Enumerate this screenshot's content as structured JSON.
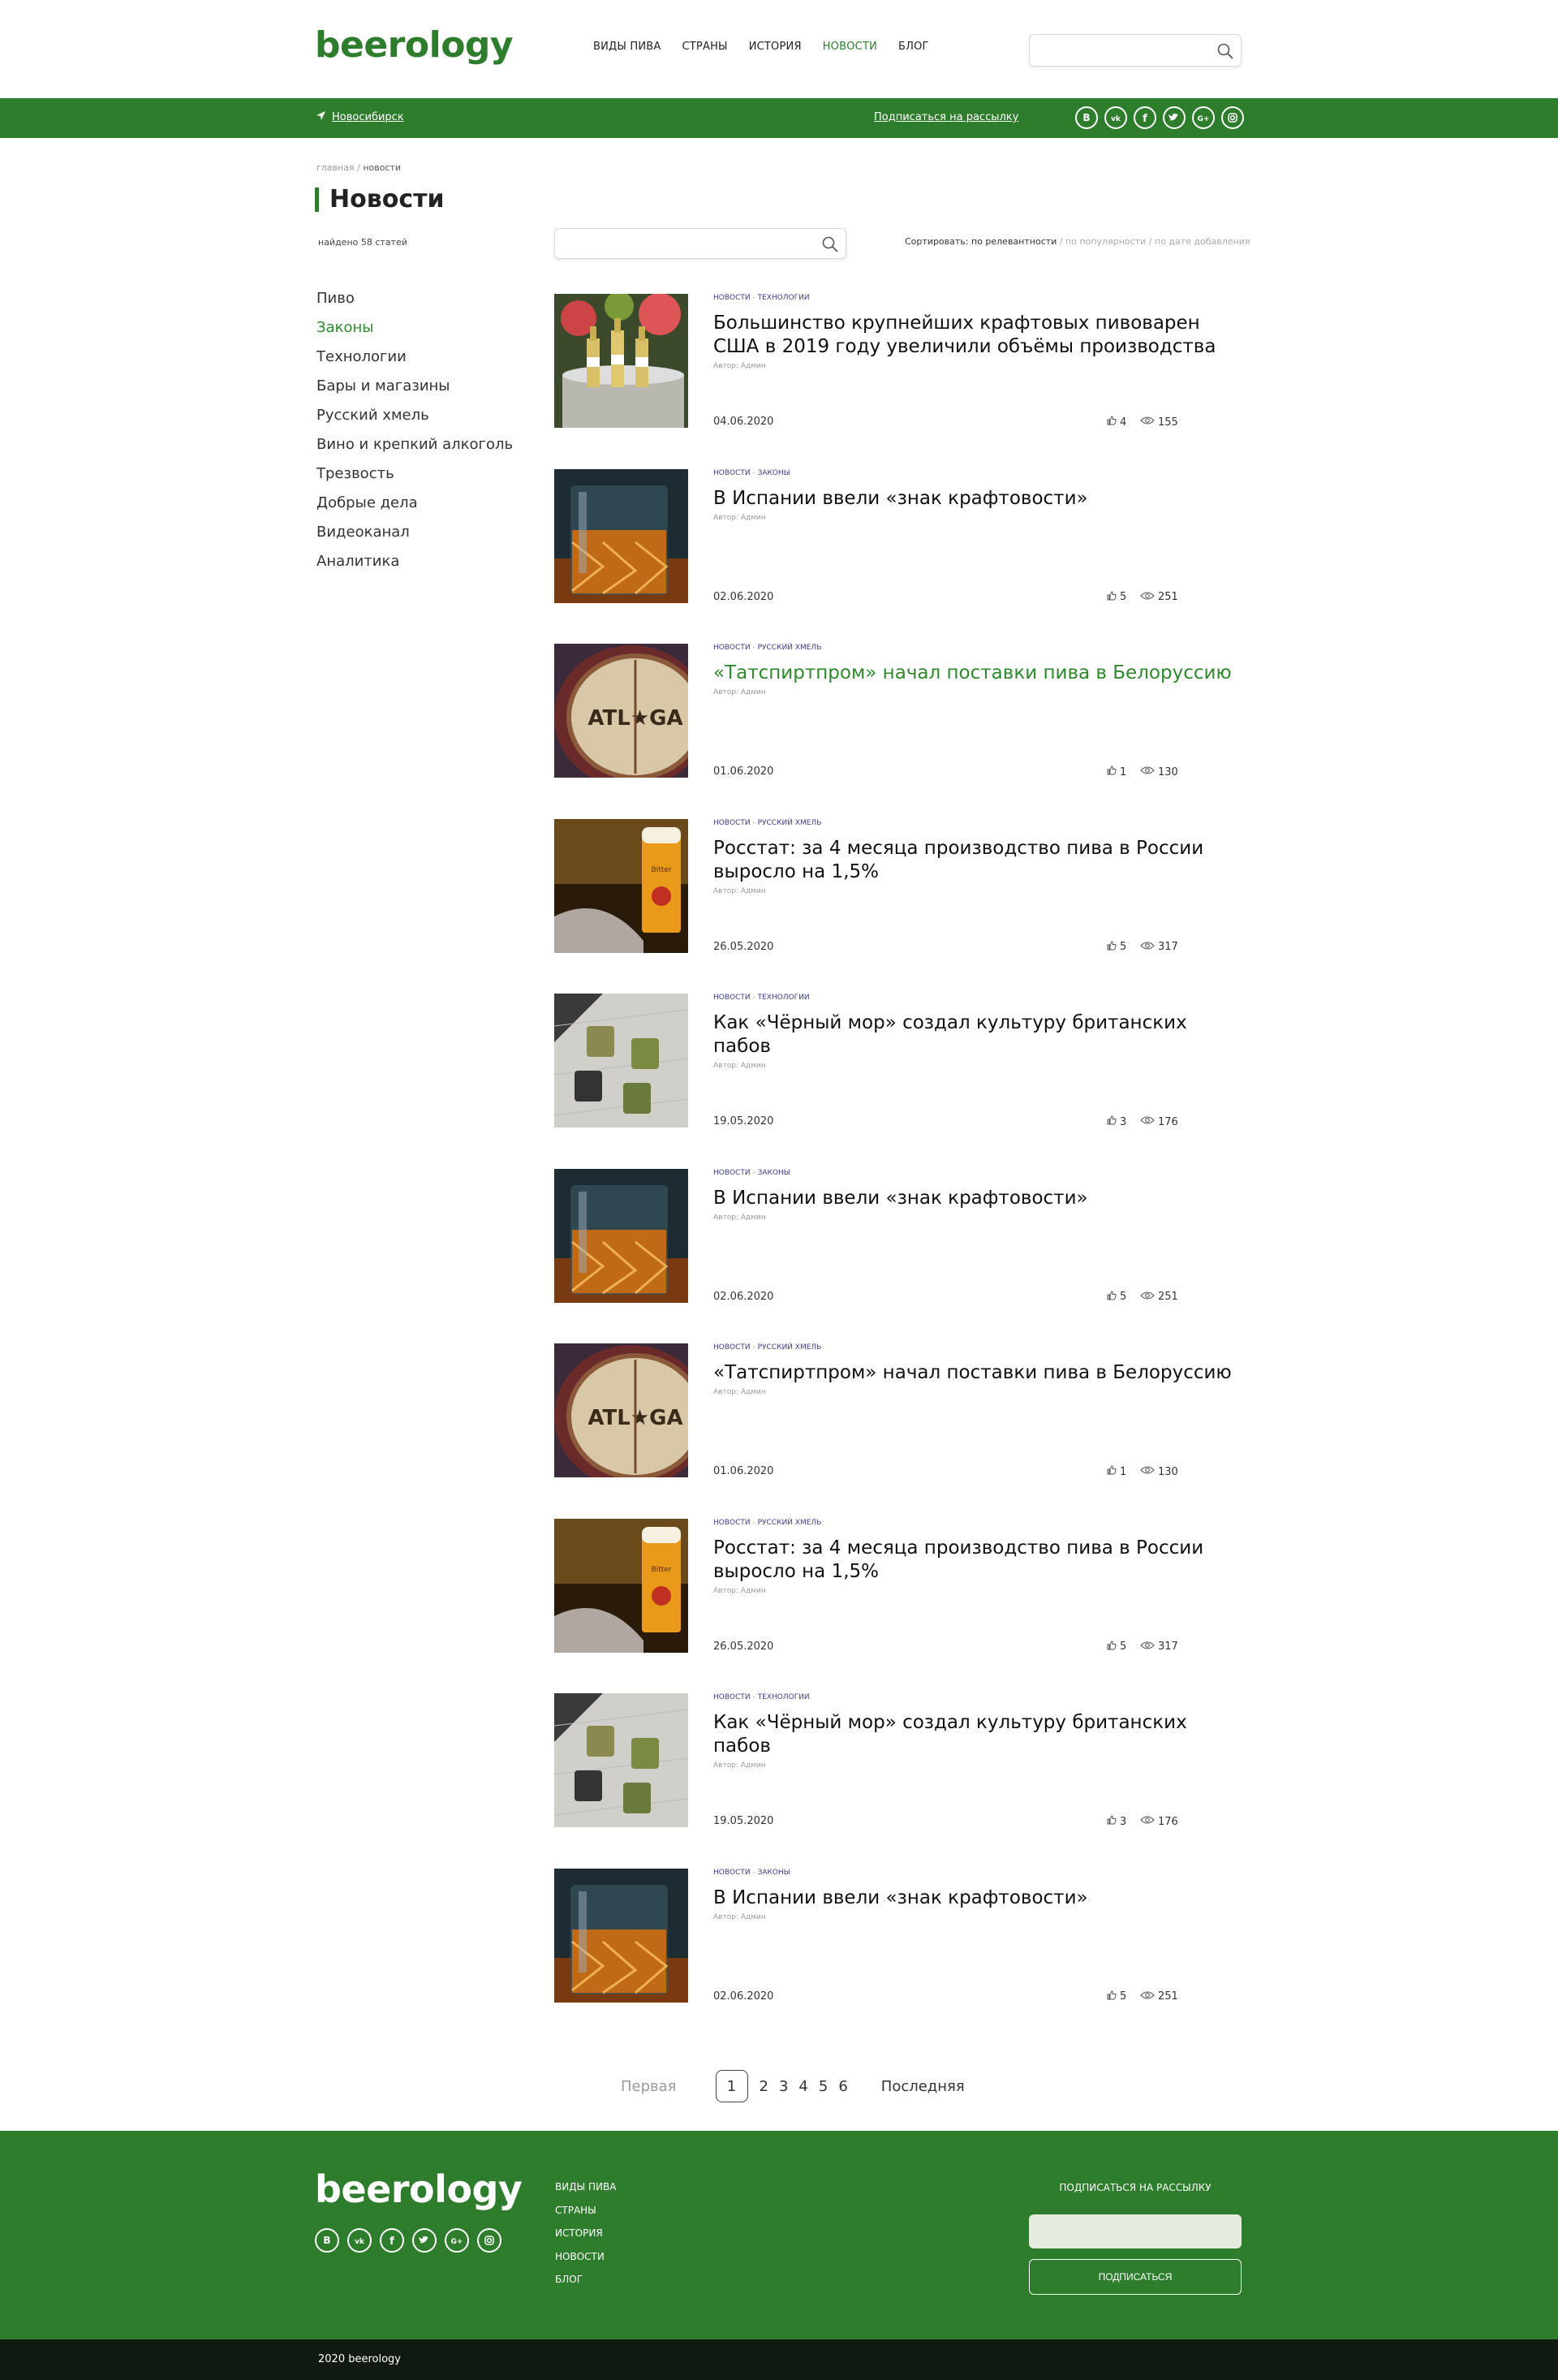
{
  "header": {
    "logo": "beerology",
    "nav": [
      {
        "label": "ВИДЫ ПИВА",
        "active": false
      },
      {
        "label": "СТРАНЫ",
        "active": false
      },
      {
        "label": "ИСТОРИЯ",
        "active": false
      },
      {
        "label": "НОВОСТИ",
        "active": true
      },
      {
        "label": "БЛОГ",
        "active": false
      }
    ],
    "search_placeholder": ""
  },
  "greenbar": {
    "city": "Новосибирск",
    "subscribe": "Подписаться на рассылку",
    "socials": [
      "В",
      "vk",
      "f",
      "twitter",
      "G+",
      "instagram"
    ]
  },
  "breadcrumb": {
    "home": "главная",
    "sep": "/",
    "current": "новости"
  },
  "page_title": "Новости",
  "found": "найдено 58 статей",
  "sort": {
    "label": "Сортировать:",
    "options": [
      {
        "label": "по релевантности",
        "active": true
      },
      {
        "label": "по популярности",
        "active": false
      },
      {
        "label": "по дате добавления",
        "active": false
      }
    ]
  },
  "sidebar": {
    "items": [
      {
        "label": "Пиво",
        "active": false
      },
      {
        "label": "Законы",
        "active": true
      },
      {
        "label": "Технологии",
        "active": false
      },
      {
        "label": "Бары и магазины",
        "active": false
      },
      {
        "label": "Русский хмель",
        "active": false
      },
      {
        "label": "Вино и крепкий алкоголь",
        "active": false
      },
      {
        "label": "Трезвость",
        "active": false
      },
      {
        "label": "Добрые дела",
        "active": false
      },
      {
        "label": "Видеоканал",
        "active": false
      },
      {
        "label": "Аналитика",
        "active": false
      }
    ]
  },
  "articles": [
    {
      "tags": [
        "новости",
        "технологии"
      ],
      "title": "Большинство крупнейших крафтовых пивоварен США в 2019 году увеличили объёмы производства",
      "author": "Автор: Админ",
      "date": "04.06.2020",
      "likes": "4",
      "views": "155",
      "image": "bottles",
      "highlight": false
    },
    {
      "tags": [
        "новости",
        "законы"
      ],
      "title": "В Испании ввели «знак крафтовости»",
      "author": "Автор: Админ",
      "date": "02.06.2020",
      "likes": "5",
      "views": "251",
      "image": "glass",
      "highlight": false
    },
    {
      "tags": [
        "новости",
        "русский хмель"
      ],
      "title": "«Татспиртпром» начал поставки пива в Белоруссию",
      "author": "Автор: Админ",
      "date": "01.06.2020",
      "likes": "1",
      "views": "130",
      "image": "barrel",
      "highlight": true
    },
    {
      "tags": [
        "новости",
        "русский хмель"
      ],
      "title": "Росстат: за 4 месяца производство пива в России выросло на 1,5%",
      "author": "Автор: Админ",
      "date": "26.05.2020",
      "likes": "5",
      "views": "317",
      "image": "beer",
      "highlight": false
    },
    {
      "tags": [
        "новости",
        "технологии"
      ],
      "title": "Как «Чёрный мор» создал культуру британских пабов",
      "author": "Автор: Админ",
      "date": "19.05.2020",
      "likes": "3",
      "views": "176",
      "image": "hops",
      "highlight": false
    },
    {
      "tags": [
        "новости",
        "законы"
      ],
      "title": "В Испании ввели «знак крафтовости»",
      "author": "Автор: Админ",
      "date": "02.06.2020",
      "likes": "5",
      "views": "251",
      "image": "glass",
      "highlight": false
    },
    {
      "tags": [
        "новости",
        "русский хмель"
      ],
      "title": "«Татспиртпром» начал поставки пива в Белоруссию",
      "author": "Автор: Админ",
      "date": "01.06.2020",
      "likes": "1",
      "views": "130",
      "image": "barrel",
      "highlight": false
    },
    {
      "tags": [
        "новости",
        "русский хмель"
      ],
      "title": "Росстат: за 4 месяца производство пива в России выросло на 1,5%",
      "author": "Автор: Админ",
      "date": "26.05.2020",
      "likes": "5",
      "views": "317",
      "image": "beer",
      "highlight": false
    },
    {
      "tags": [
        "новости",
        "технологии"
      ],
      "title": "Как «Чёрный мор» создал культуру британских пабов",
      "author": "Автор: Админ",
      "date": "19.05.2020",
      "likes": "3",
      "views": "176",
      "image": "hops",
      "highlight": false
    },
    {
      "tags": [
        "новости",
        "законы"
      ],
      "title": "В Испании ввели «знак крафтовости»",
      "author": "Автор: Админ",
      "date": "02.06.2020",
      "likes": "5",
      "views": "251",
      "image": "glass",
      "highlight": false
    }
  ],
  "pagination": {
    "first": "Первая",
    "pages": [
      "1",
      "2",
      "3",
      "4",
      "5",
      "6"
    ],
    "current": "1",
    "last": "Последняя"
  },
  "footer": {
    "logo": "beerology",
    "nav": [
      "ВИДЫ ПИВА",
      "СТРАНЫ",
      "ИСТОРИЯ",
      "НОВОСТИ",
      "БЛОГ"
    ],
    "subscribe_title": "ПОДПИСАТЬСЯ НА РАССЫЛКУ",
    "subscribe_button": "ПОДПИСАТЬСЯ",
    "copyright": "2020 beerology"
  },
  "colors": {
    "brand_green": "#2e7d2d",
    "highlight_green": "#2d8a2c",
    "tag_blue": "#3c3c8a",
    "footer_dark": "#111a11"
  }
}
